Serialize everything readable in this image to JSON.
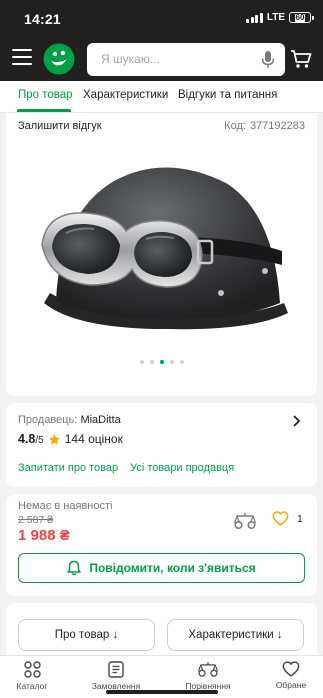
{
  "status_bar": {
    "time": "14:21",
    "network": "LTE",
    "battery": "60"
  },
  "header": {
    "search_placeholder": "Я шукаю...",
    "icons": {
      "menu": "hamburger-icon",
      "logo": "smile-logo",
      "mic": "microphone-icon",
      "cart": "cart-icon"
    }
  },
  "tabs": [
    {
      "label": "Про товар",
      "active": true
    },
    {
      "label": "Характеристики",
      "active": false
    },
    {
      "label": "Відгуки та питання",
      "active": false
    }
  ],
  "product": {
    "review_link": "Залишити відгук",
    "code_label": "Код:",
    "code_value": "377192283",
    "gallery": {
      "images_total": 5,
      "active_index": 3
    }
  },
  "seller": {
    "label": "Продавець:",
    "name": "MiaDitta",
    "rating": "4.8",
    "rating_max": "/5",
    "reviews_count": "144 оцінок",
    "ask_link": "Запитати про товар",
    "all_products_link": "Усі товари продавця"
  },
  "pricing": {
    "availability": "Немає в наявності",
    "old_price": "2 587 ₴",
    "price": "1 988 ₴",
    "wishlist_count": "1",
    "notify_button": "Повідомити, коли з'явиться"
  },
  "section_buttons": {
    "about": "Про товар ↓",
    "specs": "Характеристики ↓"
  },
  "bottom_nav": [
    {
      "label": "Каталог",
      "icon": "grid-icon"
    },
    {
      "label": "Замовлення",
      "icon": "orders-icon"
    },
    {
      "label": "Порівняння",
      "icon": "scales-icon"
    },
    {
      "label": "Обране",
      "icon": "heart-icon"
    }
  ],
  "colors": {
    "brand_green": "#00a046",
    "header_dark": "#221f1f",
    "price_red": "#f84147",
    "rating_star": "#ffa900"
  }
}
